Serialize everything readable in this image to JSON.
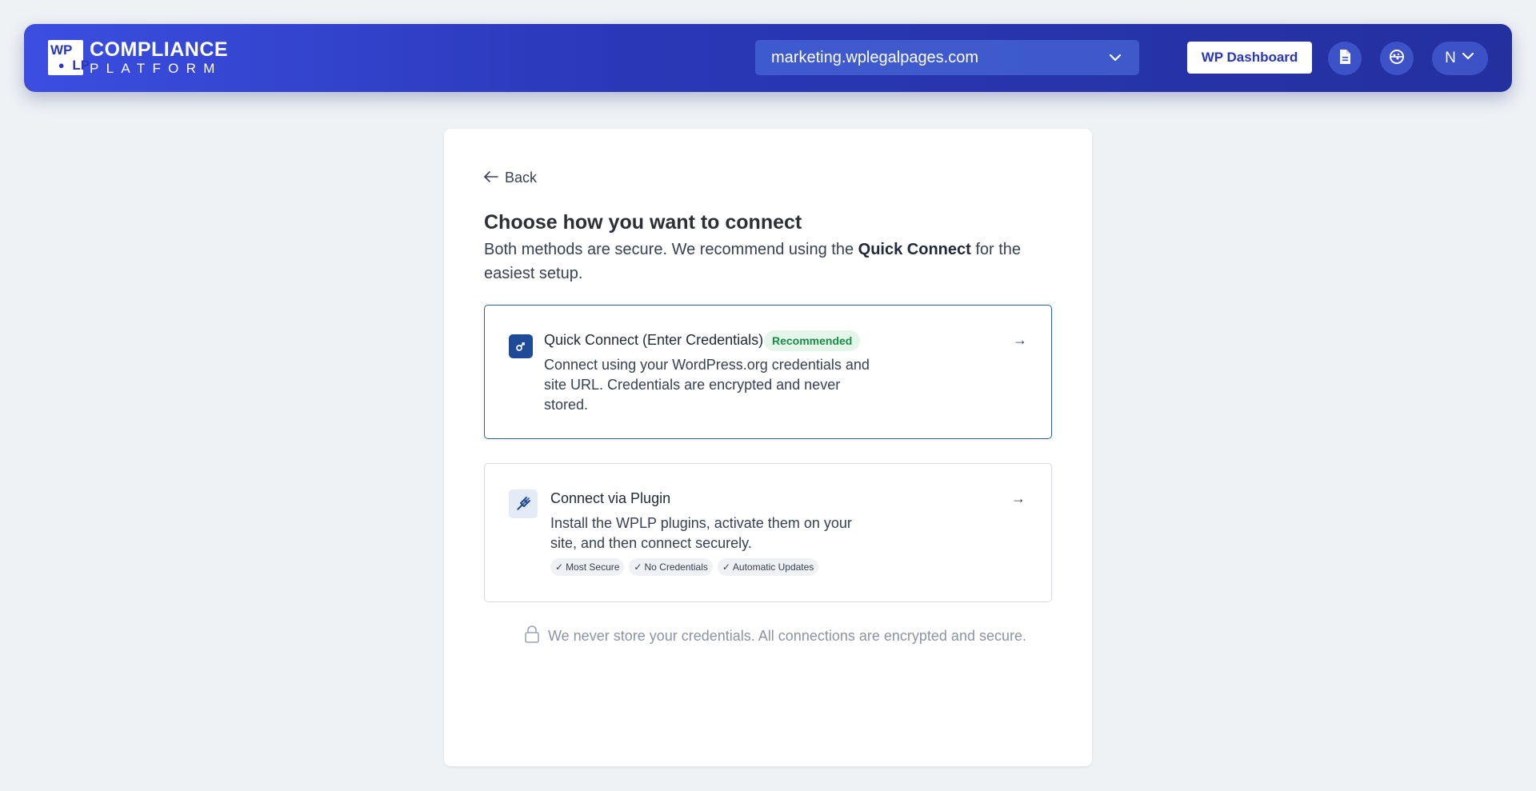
{
  "header": {
    "logo": {
      "mark": [
        "WP",
        "",
        "",
        "LP"
      ],
      "line1": "COMPLIANCE",
      "line2": "PLATFORM"
    },
    "site_selector": {
      "value": "marketing.wplegalpages.com",
      "icon": "chevron-down-icon"
    },
    "wp_dashboard_label": "WP Dashboard",
    "docs_icon": "document-icon",
    "support_icon": "cookie-icon",
    "user_initial": "N"
  },
  "card": {
    "back_label": "Back",
    "title": "Choose how you want to connect",
    "subtitle_pre": "Both methods are secure. We recommend using the ",
    "subtitle_bold": "Quick Connect",
    "subtitle_post": " for the easiest setup.",
    "options": [
      {
        "title": "Quick Connect (Enter Credentials)",
        "badge": "Recommended",
        "description": "Connect using your WordPress.org credentials and site URL. Credentials are encrypted and never stored.",
        "icon": "key-icon",
        "arrow": "→"
      },
      {
        "title": "Connect via Plugin",
        "description": "Install the WPLP plugins, activate them on your site, and then connect securely.",
        "icon": "plug-icon",
        "arrow": "→",
        "tags": [
          "Most Secure",
          "No Credentials",
          "Automatic Updates"
        ]
      }
    ],
    "footnote": "We never store your credentials. All connections are encrypted and secure."
  },
  "colors": {
    "header_start": "#3b4ee0",
    "header_end": "#24309e",
    "primary_border": "#2f5f9e",
    "badge_bg": "#e4f5ea",
    "badge_text": "#1a8c4c"
  }
}
